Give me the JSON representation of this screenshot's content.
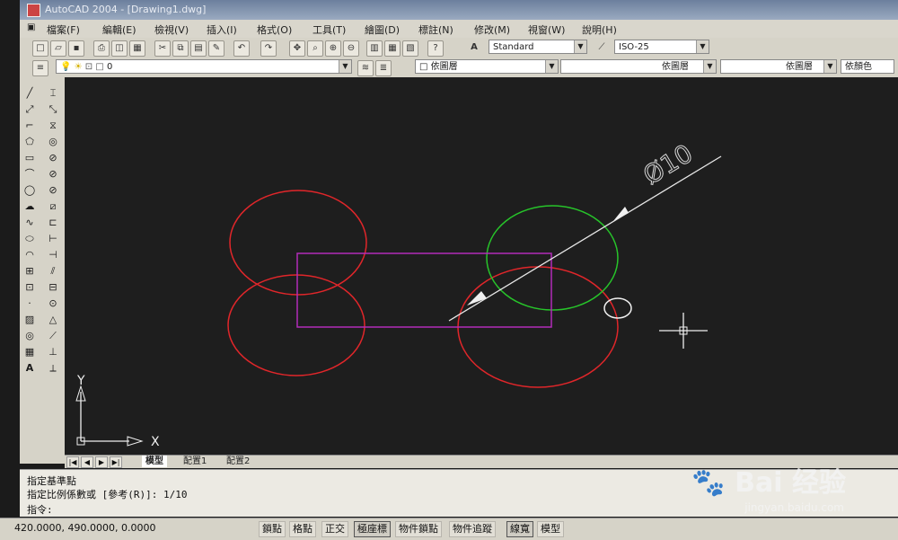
{
  "window": {
    "title": "AutoCAD 2004 - [Drawing1.dwg]"
  },
  "menu": [
    "檔案(F)",
    "編輯(E)",
    "檢視(V)",
    "插入(I)",
    "格式(O)",
    "工具(T)",
    "繪圖(D)",
    "標註(N)",
    "修改(M)",
    "視窗(W)",
    "說明(H)"
  ],
  "toolbar": {
    "text_style": "Standard",
    "dim_style": "ISO-25",
    "layer_value": "0",
    "color_value": "依圖層",
    "linetype_value": "依圖層",
    "lineweight_value": "依圖層",
    "plotstyle_value": "依顏色"
  },
  "drawing": {
    "dimension_text": "Ø10",
    "ucs_x": "X",
    "ucs_y": "Y",
    "colors": {
      "red": "#e0262a",
      "green": "#27c42a",
      "magenta": "#b22cb9",
      "white": "#f0f0f0"
    }
  },
  "tabs": [
    "模型",
    "配置1",
    "配置2"
  ],
  "command": {
    "line1": "指定基準點",
    "line2": "指定比例係數或 [參考(R)]: 1/10",
    "line3": "指令:"
  },
  "status": {
    "coords": "420.0000, 490.0000, 0.0000",
    "buttons": [
      "鎖點",
      "格點",
      "正交",
      "極座標",
      "物件鎖點",
      "物件追蹤",
      "線寬",
      "模型"
    ]
  },
  "watermark": {
    "text": "Bai 经验",
    "url": "jingyan.baidu.com"
  }
}
